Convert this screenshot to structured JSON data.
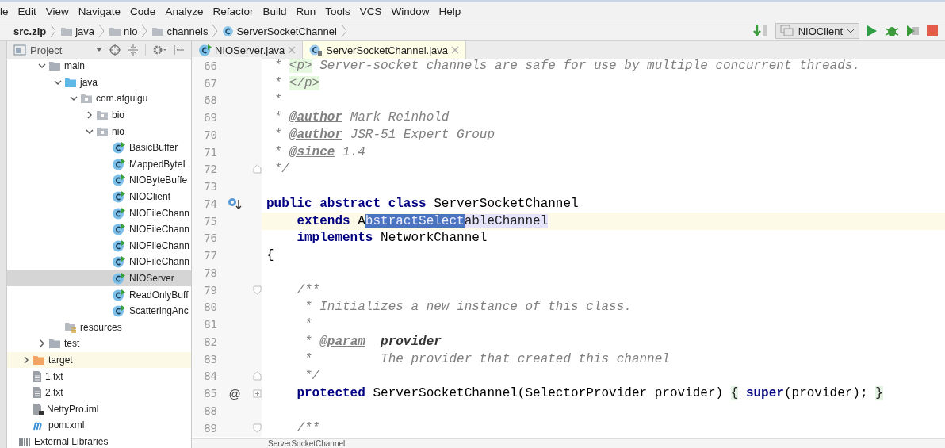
{
  "menu_bar": [
    "le",
    "Edit",
    "View",
    "Navigate",
    "Code",
    "Analyze",
    "Refactor",
    "Build",
    "Run",
    "Tools",
    "VCS",
    "Window",
    "Help"
  ],
  "breadcrumbs": [
    {
      "label": "src.zip",
      "kind": "archive"
    },
    {
      "label": "java",
      "kind": "folder"
    },
    {
      "label": "nio",
      "kind": "folder"
    },
    {
      "label": "channels",
      "kind": "folder"
    },
    {
      "label": "ServerSocketChannel",
      "kind": "class"
    }
  ],
  "run_configuration": {
    "label": "NIOClient"
  },
  "project_panel": {
    "title": "Project",
    "tree": [
      {
        "children": [
          {
            "children": [
              {
                "label": "main",
                "kind": "module-folder",
                "expanded": true,
                "selected": false,
                "hovered": false,
                "children": [
                  {
                    "label": "java",
                    "kind": "source-folder",
                    "expanded": true,
                    "selected": false,
                    "hovered": false,
                    "children": [
                      {
                        "label": "com.atguigu",
                        "kind": "package",
                        "expanded": true,
                        "selected": false,
                        "hovered": false,
                        "children": [
                          {
                            "label": "bio",
                            "kind": "package",
                            "expanded": false,
                            "selected": false,
                            "hovered": false
                          },
                          {
                            "label": "nio",
                            "kind": "package",
                            "expanded": true,
                            "selected": false,
                            "hovered": false,
                            "children": [
                              {
                                "label": "BasicBuffer",
                                "kind": "class",
                                "selected": false,
                                "hovered": false
                              },
                              {
                                "label": "MappedByteI",
                                "kind": "class",
                                "selected": false,
                                "hovered": false
                              },
                              {
                                "label": "NIOByteBuffe",
                                "kind": "class",
                                "selected": false,
                                "hovered": false
                              },
                              {
                                "label": "NIOClient",
                                "kind": "class",
                                "selected": false,
                                "hovered": false
                              },
                              {
                                "label": "NIOFileChann",
                                "kind": "class",
                                "selected": false,
                                "hovered": false
                              },
                              {
                                "label": "NIOFileChann",
                                "kind": "class",
                                "selected": false,
                                "hovered": false
                              },
                              {
                                "label": "NIOFileChann",
                                "kind": "class",
                                "selected": false,
                                "hovered": false
                              },
                              {
                                "label": "NIOFileChann",
                                "kind": "class",
                                "selected": false,
                                "hovered": false
                              },
                              {
                                "label": "NIOServer",
                                "kind": "class",
                                "selected": true,
                                "hovered": false
                              },
                              {
                                "label": "ReadOnlyBuff",
                                "kind": "class",
                                "selected": false,
                                "hovered": false
                              },
                              {
                                "label": "ScatteringAnc",
                                "kind": "class",
                                "selected": false,
                                "hovered": false
                              }
                            ]
                          }
                        ]
                      }
                    ]
                  },
                  {
                    "label": "resources",
                    "kind": "resources-folder",
                    "selected": false,
                    "hovered": false
                  }
                ]
              },
              {
                "label": "test",
                "kind": "module-folder",
                "expanded": false,
                "selected": false,
                "hovered": false
              }
            ]
          },
          {
            "label": "target",
            "kind": "excluded-folder",
            "expanded": false,
            "selected": false,
            "hovered": true
          },
          {
            "label": "1.txt",
            "kind": "text-file",
            "selected": false,
            "hovered": false
          },
          {
            "label": "2.txt",
            "kind": "text-file",
            "selected": false,
            "hovered": false
          },
          {
            "label": "NettyPro.iml",
            "kind": "module-file",
            "selected": false,
            "hovered": false
          },
          {
            "label": "pom.xml",
            "kind": "maven-file",
            "selected": false,
            "hovered": false
          }
        ]
      },
      {
        "label": "External Libraries",
        "kind": "libraries",
        "selected": false,
        "hovered": false
      }
    ]
  },
  "editor_tabs": [
    {
      "label": "NIOServer.java",
      "kind": "class",
      "selected": false
    },
    {
      "label": "ServerSocketChannel.java",
      "kind": "locked-class",
      "selected": true
    }
  ],
  "code_lines": [
    {
      "number": "66",
      "current": false,
      "fold_start": false,
      "fold_end": false,
      "fold_collapsed": false,
      "implemented_marker": false,
      "tokens": [
        {
          "kind": "comment",
          "text": " * "
        },
        {
          "kind": "html",
          "text": "<p>"
        },
        {
          "kind": "comment",
          "text": " Server-socket channels are safe for use by multiple concurrent threads."
        }
      ]
    },
    {
      "number": "67",
      "current": false,
      "fold_start": false,
      "fold_end": false,
      "fold_collapsed": false,
      "implemented_marker": false,
      "tokens": [
        {
          "kind": "comment",
          "text": " * "
        },
        {
          "kind": "html",
          "text": "</p>"
        }
      ]
    },
    {
      "number": "68",
      "current": false,
      "fold_start": false,
      "fold_end": false,
      "fold_collapsed": false,
      "implemented_marker": false,
      "tokens": [
        {
          "kind": "comment",
          "text": " *"
        }
      ]
    },
    {
      "number": "69",
      "current": false,
      "fold_start": false,
      "fold_end": false,
      "fold_collapsed": false,
      "implemented_marker": false,
      "tokens": [
        {
          "kind": "comment",
          "text": " * "
        },
        {
          "kind": "tag",
          "text": "@author"
        },
        {
          "kind": "comment",
          "text": " Mark Reinhold"
        }
      ]
    },
    {
      "number": "70",
      "current": false,
      "fold_start": false,
      "fold_end": false,
      "fold_collapsed": false,
      "implemented_marker": false,
      "tokens": [
        {
          "kind": "comment",
          "text": " * "
        },
        {
          "kind": "tag",
          "text": "@author"
        },
        {
          "kind": "comment",
          "text": " JSR-51 Expert Group"
        }
      ]
    },
    {
      "number": "71",
      "current": false,
      "fold_start": false,
      "fold_end": false,
      "fold_collapsed": false,
      "implemented_marker": false,
      "tokens": [
        {
          "kind": "comment",
          "text": " * "
        },
        {
          "kind": "tag",
          "text": "@since"
        },
        {
          "kind": "comment",
          "text": " 1.4"
        }
      ]
    },
    {
      "number": "72",
      "current": false,
      "fold_start": false,
      "fold_end": true,
      "fold_collapsed": false,
      "implemented_marker": false,
      "tokens": [
        {
          "kind": "comment",
          "text": " */"
        }
      ]
    },
    {
      "number": "73",
      "current": false,
      "fold_start": false,
      "fold_end": false,
      "fold_collapsed": false,
      "implemented_marker": false
    },
    {
      "number": "74",
      "current": false,
      "fold_start": false,
      "fold_end": false,
      "fold_collapsed": false,
      "implemented_marker": true,
      "tokens": [
        {
          "kind": "keyword",
          "text": "public abstract class"
        },
        {
          "kind": "plain",
          "text": " ServerSocketChannel"
        }
      ]
    },
    {
      "number": "75",
      "current": true,
      "fold_start": false,
      "fold_end": false,
      "fold_collapsed": false,
      "implemented_marker": false,
      "tokens": [
        {
          "kind": "keyword",
          "text": "    extends"
        },
        {
          "kind": "plain",
          "text": " A"
        },
        {
          "kind": "selection",
          "text": "bstractSelect"
        },
        {
          "kind": "usage",
          "text": "ableChannel"
        }
      ]
    },
    {
      "number": "76",
      "current": false,
      "fold_start": false,
      "fold_end": false,
      "fold_collapsed": false,
      "implemented_marker": false,
      "tokens": [
        {
          "kind": "keyword",
          "text": "    implements"
        },
        {
          "kind": "plain",
          "text": " NetworkChannel"
        }
      ]
    },
    {
      "number": "77",
      "current": false,
      "fold_start": false,
      "fold_end": false,
      "fold_collapsed": false,
      "implemented_marker": false,
      "tokens": [
        {
          "kind": "plain",
          "text": "{"
        }
      ]
    },
    {
      "number": "78",
      "current": false,
      "fold_start": false,
      "fold_end": false,
      "fold_collapsed": false,
      "implemented_marker": false
    },
    {
      "number": "79",
      "current": false,
      "fold_start": true,
      "fold_end": false,
      "fold_collapsed": false,
      "implemented_marker": false,
      "tokens": [
        {
          "kind": "comment",
          "text": "    /**"
        }
      ]
    },
    {
      "number": "80",
      "current": false,
      "fold_start": false,
      "fold_end": false,
      "fold_collapsed": false,
      "implemented_marker": false,
      "tokens": [
        {
          "kind": "comment",
          "text": "     * Initializes a new instance of this class."
        }
      ]
    },
    {
      "number": "81",
      "current": false,
      "fold_start": false,
      "fold_end": false,
      "fold_collapsed": false,
      "implemented_marker": false,
      "tokens": [
        {
          "kind": "comment",
          "text": "     *"
        }
      ]
    },
    {
      "number": "82",
      "current": false,
      "fold_start": false,
      "fold_end": false,
      "fold_collapsed": false,
      "implemented_marker": false,
      "tokens": [
        {
          "kind": "comment",
          "text": "     * "
        },
        {
          "kind": "tag",
          "text": "@param"
        },
        {
          "kind": "param",
          "text": "  provider"
        }
      ]
    },
    {
      "number": "83",
      "current": false,
      "fold_start": false,
      "fold_end": false,
      "fold_collapsed": false,
      "implemented_marker": false,
      "tokens": [
        {
          "kind": "comment",
          "text": "     *         The provider that created this channel"
        }
      ]
    },
    {
      "number": "84",
      "current": false,
      "fold_start": false,
      "fold_end": true,
      "fold_collapsed": false,
      "implemented_marker": false,
      "tokens": [
        {
          "kind": "comment",
          "text": "     */"
        }
      ]
    },
    {
      "number": "85",
      "current": false,
      "fold_start": false,
      "fold_end": false,
      "fold_collapsed": true,
      "implemented_marker": false,
      "gutter_text": "@",
      "tokens": [
        {
          "kind": "keyword",
          "text": "    protected"
        },
        {
          "kind": "plain",
          "text": " ServerSocketChannel(SelectorProvider provider) "
        },
        {
          "kind": "fold_brace",
          "text": "{"
        },
        {
          "kind": "keyword",
          "text": " super"
        },
        {
          "kind": "plain",
          "text": "(provider); "
        },
        {
          "kind": "fold_brace",
          "text": "}"
        }
      ]
    },
    {
      "number": "88",
      "current": false,
      "fold_start": false,
      "fold_end": false,
      "fold_collapsed": false,
      "implemented_marker": false
    },
    {
      "number": "89",
      "current": false,
      "fold_start": true,
      "fold_end": false,
      "fold_collapsed": false,
      "implemented_marker": false,
      "tokens": [
        {
          "kind": "comment",
          "text": "    /**"
        }
      ]
    }
  ],
  "editor_breadcrumb": "ServerSocketChannel"
}
